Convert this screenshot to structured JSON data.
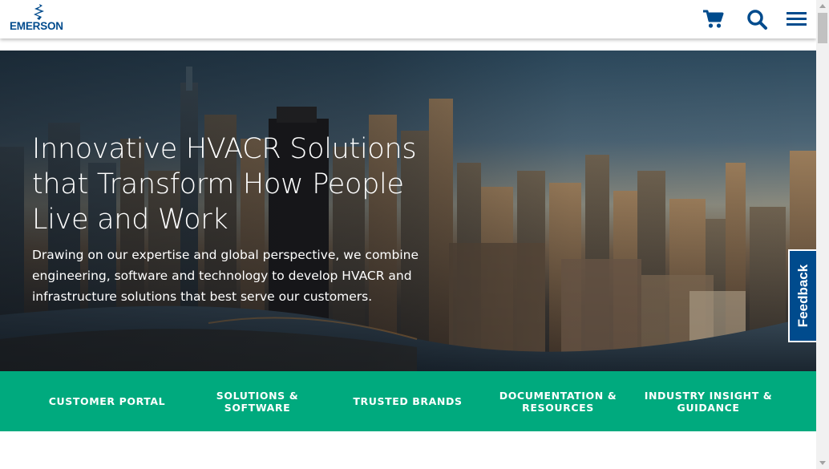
{
  "header": {
    "logo_text": "EMERSON",
    "icons": [
      "cart-icon",
      "search-icon",
      "menu-icon"
    ]
  },
  "hero": {
    "title": "Innovative HVACR Solutions that Transform How People Live and Work",
    "description": "Drawing on our expertise and global perspective, we combine engineering, software and technology to develop HVACR and infrastructure solutions that best serve our customers."
  },
  "feedback": {
    "label": "Feedback"
  },
  "nav_band": {
    "items": [
      {
        "label": "CUSTOMER PORTAL"
      },
      {
        "label": "SOLUTIONS & SOFTWARE"
      },
      {
        "label": "TRUSTED BRANDS"
      },
      {
        "label": "DOCUMENTATION & RESOURCES"
      },
      {
        "label": "INDUSTRY INSIGHT & GUIDANCE"
      }
    ]
  },
  "colors": {
    "brand_blue": "#004b8d",
    "band_green": "#00aa7e",
    "white": "#ffffff"
  }
}
